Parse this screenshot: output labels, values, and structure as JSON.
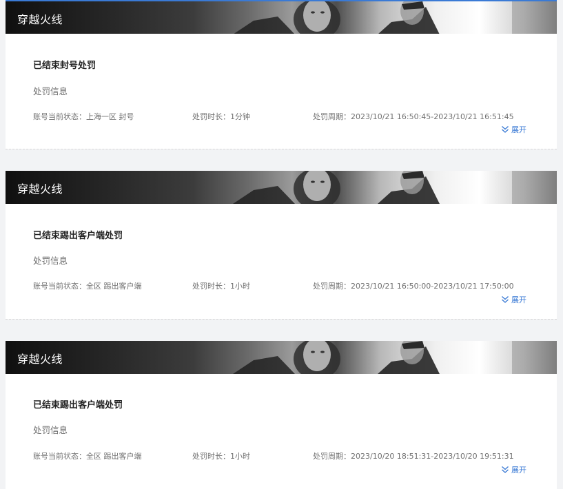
{
  "records": [
    {
      "game_name": "穿越火线",
      "title": "已结束封号处罚",
      "info_label": "处罚信息",
      "status": "账号当前状态：上海一区 封号",
      "duration": "处罚时长：1分钟",
      "period": "处罚周期：2023/10/21 16:50:45-2023/10/21 16:51:45",
      "expand_label": "展开"
    },
    {
      "game_name": "穿越火线",
      "title": "已结束踢出客户端处罚",
      "info_label": "处罚信息",
      "status": "账号当前状态：全区 踢出客户端",
      "duration": "处罚时长：1小时",
      "period": "处罚周期：2023/10/21 16:50:00-2023/10/21 17:50:00",
      "expand_label": "展开"
    },
    {
      "game_name": "穿越火线",
      "title": "已结束踢出客户端处罚",
      "info_label": "处罚信息",
      "status": "账号当前状态：全区 踢出客户端",
      "duration": "处罚时长：1小时",
      "period": "处罚周期：2023/10/20 18:51:31-2023/10/20 19:51:31",
      "expand_label": "展开"
    }
  ],
  "colors": {
    "accent": "#3a7ad5",
    "title_text": "#222222",
    "meta_text": "#707070",
    "background": "#f2f3f5",
    "card": "#ffffff"
  },
  "icons": {
    "expand": "double-chevron-down-icon"
  }
}
